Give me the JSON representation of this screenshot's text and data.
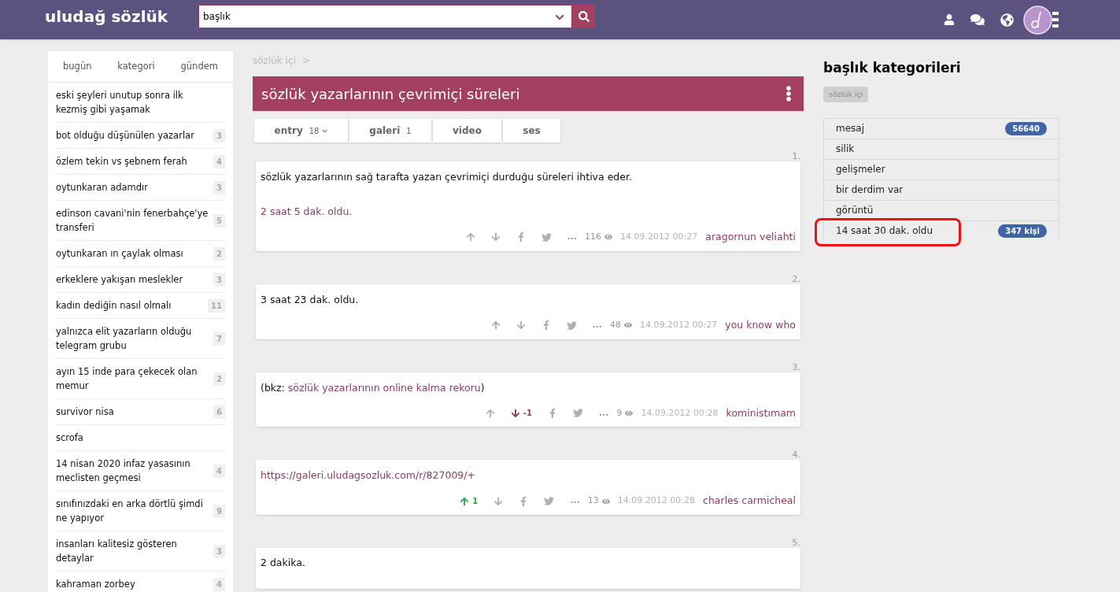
{
  "header": {
    "logo": "uludağ sözlük",
    "search": {
      "value": "başlık"
    }
  },
  "sidebar": {
    "tabs": [
      {
        "label": "bugün",
        "selected": false
      },
      {
        "label": "kategori",
        "selected": false
      },
      {
        "label": "gündem",
        "selected": false
      }
    ],
    "items": [
      {
        "title": "eski şeyleri unutup sonra ilk kezmiş gibi yaşamak"
      },
      {
        "title": "bot olduğu düşünülen yazarlar",
        "count": "3"
      },
      {
        "title": "özlem tekin vs şebnem ferah",
        "count": "4"
      },
      {
        "title": "oytunkaran adamdır",
        "count": "3"
      },
      {
        "title": "edinson cavani'nin fenerbahçe'ye transferi",
        "count": "5"
      },
      {
        "title": "oytunkaran ın çaylak olması",
        "count": "2"
      },
      {
        "title": "erkeklere yakışan meslekler",
        "count": "3"
      },
      {
        "title": "kadın dediğin nasıl olmalı",
        "count": "11"
      },
      {
        "title": "yalnızca elit yazarların olduğu telegram grubu",
        "count": "7"
      },
      {
        "title": "ayın 15 inde para çekecek olan memur",
        "count": "2"
      },
      {
        "title": "survivor nisa",
        "count": "6"
      },
      {
        "title": "scrofa"
      },
      {
        "title": "14 nisan 2020 infaz yasasının meclisten geçmesi",
        "count": "4"
      },
      {
        "title": "sınıfınızdaki en arka dörtlü şimdi ne yapıyor",
        "count": "9"
      },
      {
        "title": "insanları kalitesiz gösteren detaylar",
        "count": "3"
      },
      {
        "title": "kahraman zorbey",
        "count": "4"
      }
    ]
  },
  "breadcrumb": "sözlük içi",
  "breadcrumb_separator": ">",
  "topic": {
    "title": "sözlük yazarlarının çevrimiçi süreleri"
  },
  "tabs": [
    {
      "label": "entry",
      "count": "18",
      "dropdown": true,
      "selected": false
    },
    {
      "label": "galeri",
      "count": "1",
      "dropdown": false,
      "selected": false
    },
    {
      "label": "video",
      "dropdown": false,
      "selected": false
    },
    {
      "label": "ses",
      "dropdown": false,
      "selected": false
    }
  ],
  "entries": [
    {
      "number": "1.",
      "lines": [
        [
          {
            "kind": "text",
            "text": "sözlük yazarlarının sağ tarafta yazan çevrimiçi durduğu süreleri ihtiva eder."
          }
        ],
        [
          {
            "kind": "link",
            "text": "2 saat 5 dak. oldu."
          }
        ]
      ],
      "upvoted": false,
      "downvoted": false,
      "views": "116",
      "date": "14.09.2012 00:27",
      "author": "aragornun veliahti"
    },
    {
      "number": "2.",
      "lines": [
        [
          {
            "kind": "text",
            "text": "3 saat 23 dak. oldu."
          }
        ]
      ],
      "upvoted": false,
      "downvoted": false,
      "views": "48",
      "date": "14.09.2012 00:27",
      "author": "you know who"
    },
    {
      "number": "3.",
      "lines": [
        [
          {
            "kind": "text",
            "text": "(bkz: "
          },
          {
            "kind": "link",
            "text": "sözlük yazarlarının online kalma rekoru"
          },
          {
            "kind": "text",
            "text": ")"
          }
        ]
      ],
      "upvoted": false,
      "downvoted": true,
      "score": "-1",
      "views": "9",
      "date": "14.09.2012 00:28",
      "author": "koministımam"
    },
    {
      "number": "4.",
      "lines": [
        [
          {
            "kind": "link",
            "text": "https://galeri.uludagsozluk.com/r/827009/+"
          }
        ]
      ],
      "upvoted": true,
      "downvoted": false,
      "score": "1",
      "views": "13",
      "date": "14.09.2012 00:28",
      "author": "charles carmicheal"
    },
    {
      "number": "5.",
      "lines": [
        [
          {
            "kind": "text",
            "text": "2 dakika."
          }
        ]
      ]
    }
  ],
  "more": "...",
  "right": {
    "title": "başlık kategorileri",
    "tag": "sözlük içi",
    "items": [
      {
        "label": "mesaj",
        "badge": "56640",
        "highlighted": false
      },
      {
        "label": "silik",
        "highlighted": false
      },
      {
        "label": "gelişmeler",
        "highlighted": false
      },
      {
        "label": "bir derdim var",
        "highlighted": false
      },
      {
        "label": "görüntü",
        "highlighted": false
      },
      {
        "label": "14 saat 30 dak. oldu",
        "badge": "347 kişi",
        "highlighted": true
      }
    ]
  }
}
